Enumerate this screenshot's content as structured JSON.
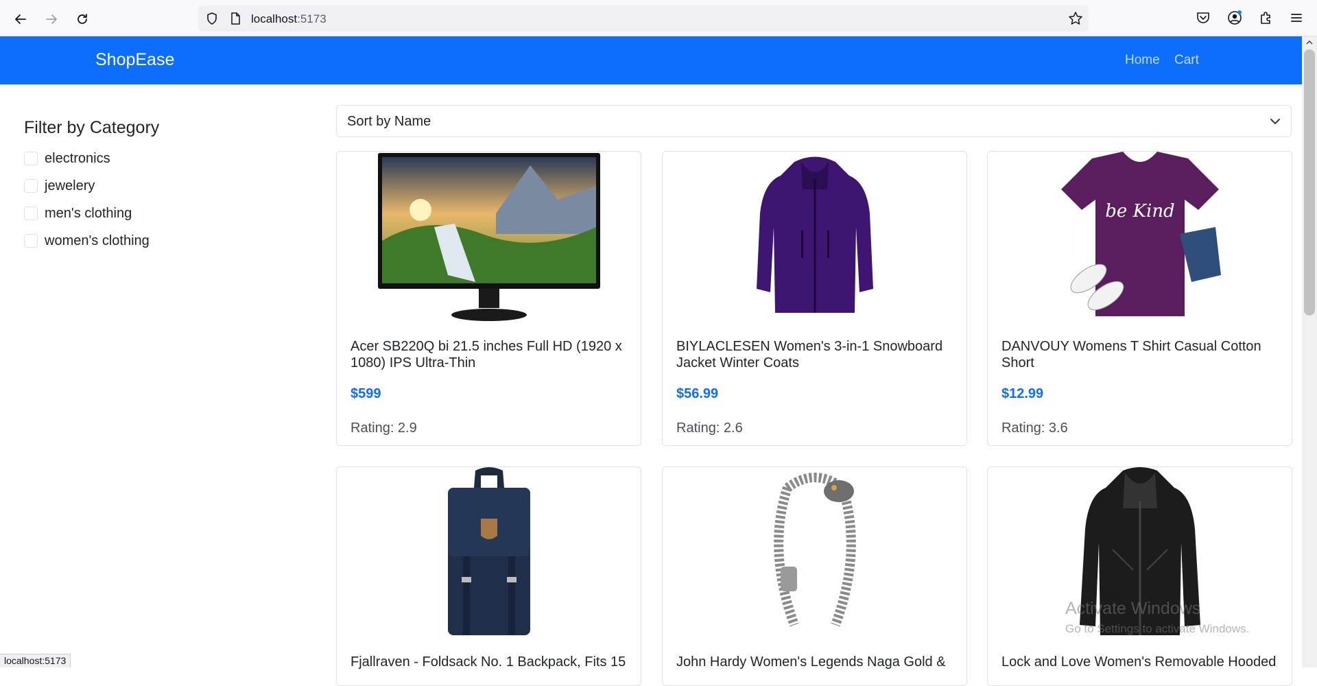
{
  "browser": {
    "url_host": "localhost",
    "url_port": ":5173",
    "status_text": "localhost:5173"
  },
  "app": {
    "brand": "ShopEase",
    "nav": [
      {
        "label": "Home"
      },
      {
        "label": "Cart"
      }
    ],
    "accent_color": "#0d6efd"
  },
  "filters": {
    "title": "Filter by Category",
    "categories": [
      {
        "label": "electronics",
        "checked": false
      },
      {
        "label": "jewelery",
        "checked": false
      },
      {
        "label": "men's clothing",
        "checked": false
      },
      {
        "label": "women's clothing",
        "checked": false
      }
    ]
  },
  "sort": {
    "selected": "Sort by Name"
  },
  "products": [
    {
      "title": "Acer SB220Q bi 21.5 inches Full HD (1920 x 1080) IPS Ultra-Thin",
      "price": "$599",
      "rating": "Rating: 2.9",
      "image": "monitor"
    },
    {
      "title": "BIYLACLESEN Women's 3-in-1 Snowboard Jacket Winter Coats",
      "price": "$56.99",
      "rating": "Rating: 2.6",
      "image": "purple-jacket"
    },
    {
      "title": "DANVOUY Womens T Shirt Casual Cotton Short",
      "price": "$12.99",
      "rating": "Rating: 3.6",
      "image": "be-kind-tshirt"
    },
    {
      "title": "Fjallraven - Foldsack No. 1 Backpack, Fits 15",
      "price": "",
      "rating": "",
      "image": "backpack"
    },
    {
      "title": "John Hardy Women's Legends Naga Gold &",
      "price": "",
      "rating": "",
      "image": "bracelet"
    },
    {
      "title": "Lock and Love Women's Removable Hooded",
      "price": "",
      "rating": "",
      "image": "leather-jacket"
    }
  ],
  "tshirt_print": "be Kind",
  "watermark": {
    "line1": "Activate Windows",
    "line2": "Go to Settings to activate Windows."
  }
}
